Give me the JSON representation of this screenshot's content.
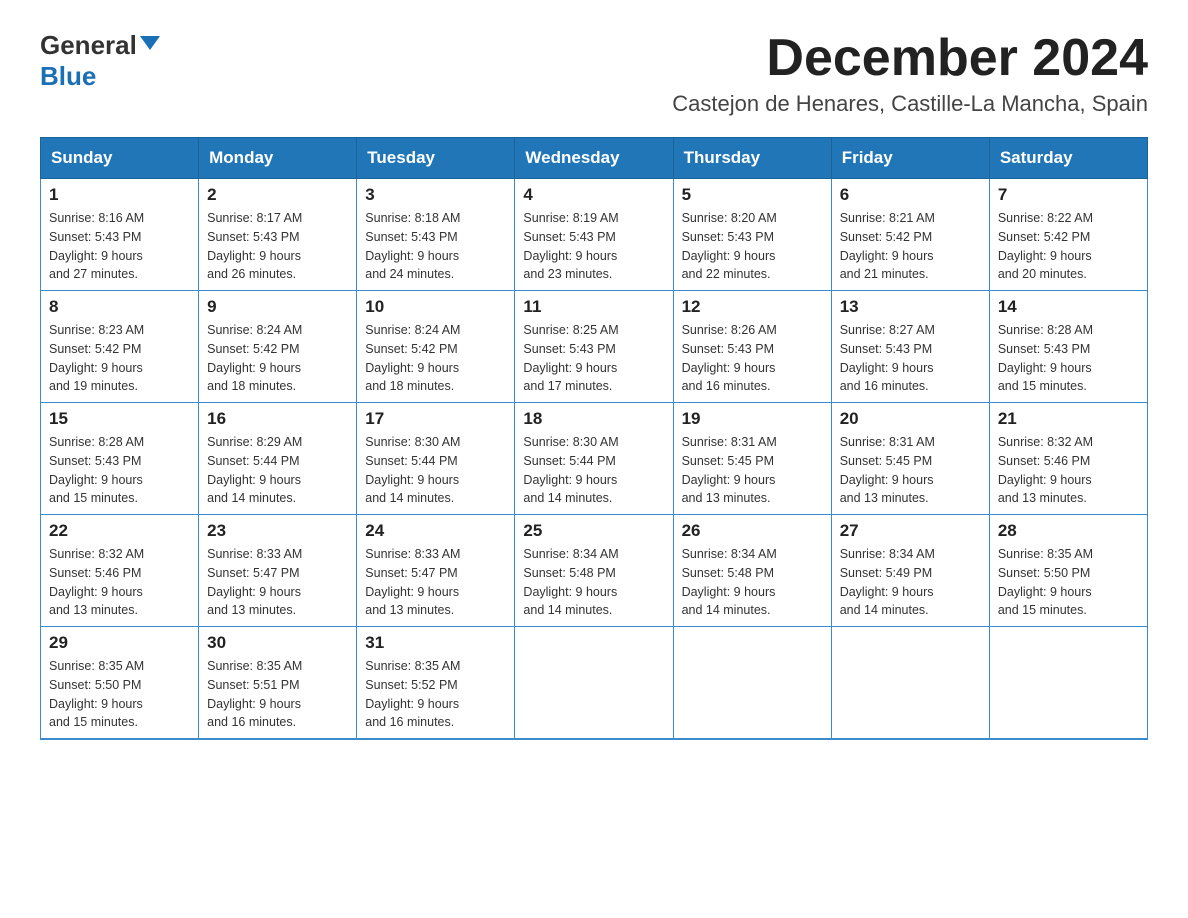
{
  "header": {
    "logo_general": "General",
    "logo_blue": "Blue",
    "month_title": "December 2024",
    "location": "Castejon de Henares, Castille-La Mancha, Spain"
  },
  "weekdays": [
    "Sunday",
    "Monday",
    "Tuesday",
    "Wednesday",
    "Thursday",
    "Friday",
    "Saturday"
  ],
  "weeks": [
    [
      {
        "day": "1",
        "sunrise": "8:16 AM",
        "sunset": "5:43 PM",
        "daylight": "9 hours and 27 minutes."
      },
      {
        "day": "2",
        "sunrise": "8:17 AM",
        "sunset": "5:43 PM",
        "daylight": "9 hours and 26 minutes."
      },
      {
        "day": "3",
        "sunrise": "8:18 AM",
        "sunset": "5:43 PM",
        "daylight": "9 hours and 24 minutes."
      },
      {
        "day": "4",
        "sunrise": "8:19 AM",
        "sunset": "5:43 PM",
        "daylight": "9 hours and 23 minutes."
      },
      {
        "day": "5",
        "sunrise": "8:20 AM",
        "sunset": "5:43 PM",
        "daylight": "9 hours and 22 minutes."
      },
      {
        "day": "6",
        "sunrise": "8:21 AM",
        "sunset": "5:42 PM",
        "daylight": "9 hours and 21 minutes."
      },
      {
        "day": "7",
        "sunrise": "8:22 AM",
        "sunset": "5:42 PM",
        "daylight": "9 hours and 20 minutes."
      }
    ],
    [
      {
        "day": "8",
        "sunrise": "8:23 AM",
        "sunset": "5:42 PM",
        "daylight": "9 hours and 19 minutes."
      },
      {
        "day": "9",
        "sunrise": "8:24 AM",
        "sunset": "5:42 PM",
        "daylight": "9 hours and 18 minutes."
      },
      {
        "day": "10",
        "sunrise": "8:24 AM",
        "sunset": "5:42 PM",
        "daylight": "9 hours and 18 minutes."
      },
      {
        "day": "11",
        "sunrise": "8:25 AM",
        "sunset": "5:43 PM",
        "daylight": "9 hours and 17 minutes."
      },
      {
        "day": "12",
        "sunrise": "8:26 AM",
        "sunset": "5:43 PM",
        "daylight": "9 hours and 16 minutes."
      },
      {
        "day": "13",
        "sunrise": "8:27 AM",
        "sunset": "5:43 PM",
        "daylight": "9 hours and 16 minutes."
      },
      {
        "day": "14",
        "sunrise": "8:28 AM",
        "sunset": "5:43 PM",
        "daylight": "9 hours and 15 minutes."
      }
    ],
    [
      {
        "day": "15",
        "sunrise": "8:28 AM",
        "sunset": "5:43 PM",
        "daylight": "9 hours and 15 minutes."
      },
      {
        "day": "16",
        "sunrise": "8:29 AM",
        "sunset": "5:44 PM",
        "daylight": "9 hours and 14 minutes."
      },
      {
        "day": "17",
        "sunrise": "8:30 AM",
        "sunset": "5:44 PM",
        "daylight": "9 hours and 14 minutes."
      },
      {
        "day": "18",
        "sunrise": "8:30 AM",
        "sunset": "5:44 PM",
        "daylight": "9 hours and 14 minutes."
      },
      {
        "day": "19",
        "sunrise": "8:31 AM",
        "sunset": "5:45 PM",
        "daylight": "9 hours and 13 minutes."
      },
      {
        "day": "20",
        "sunrise": "8:31 AM",
        "sunset": "5:45 PM",
        "daylight": "9 hours and 13 minutes."
      },
      {
        "day": "21",
        "sunrise": "8:32 AM",
        "sunset": "5:46 PM",
        "daylight": "9 hours and 13 minutes."
      }
    ],
    [
      {
        "day": "22",
        "sunrise": "8:32 AM",
        "sunset": "5:46 PM",
        "daylight": "9 hours and 13 minutes."
      },
      {
        "day": "23",
        "sunrise": "8:33 AM",
        "sunset": "5:47 PM",
        "daylight": "9 hours and 13 minutes."
      },
      {
        "day": "24",
        "sunrise": "8:33 AM",
        "sunset": "5:47 PM",
        "daylight": "9 hours and 13 minutes."
      },
      {
        "day": "25",
        "sunrise": "8:34 AM",
        "sunset": "5:48 PM",
        "daylight": "9 hours and 14 minutes."
      },
      {
        "day": "26",
        "sunrise": "8:34 AM",
        "sunset": "5:48 PM",
        "daylight": "9 hours and 14 minutes."
      },
      {
        "day": "27",
        "sunrise": "8:34 AM",
        "sunset": "5:49 PM",
        "daylight": "9 hours and 14 minutes."
      },
      {
        "day": "28",
        "sunrise": "8:35 AM",
        "sunset": "5:50 PM",
        "daylight": "9 hours and 15 minutes."
      }
    ],
    [
      {
        "day": "29",
        "sunrise": "8:35 AM",
        "sunset": "5:50 PM",
        "daylight": "9 hours and 15 minutes."
      },
      {
        "day": "30",
        "sunrise": "8:35 AM",
        "sunset": "5:51 PM",
        "daylight": "9 hours and 16 minutes."
      },
      {
        "day": "31",
        "sunrise": "8:35 AM",
        "sunset": "5:52 PM",
        "daylight": "9 hours and 16 minutes."
      },
      null,
      null,
      null,
      null
    ]
  ],
  "labels": {
    "sunrise": "Sunrise:",
    "sunset": "Sunset:",
    "daylight": "Daylight:"
  }
}
